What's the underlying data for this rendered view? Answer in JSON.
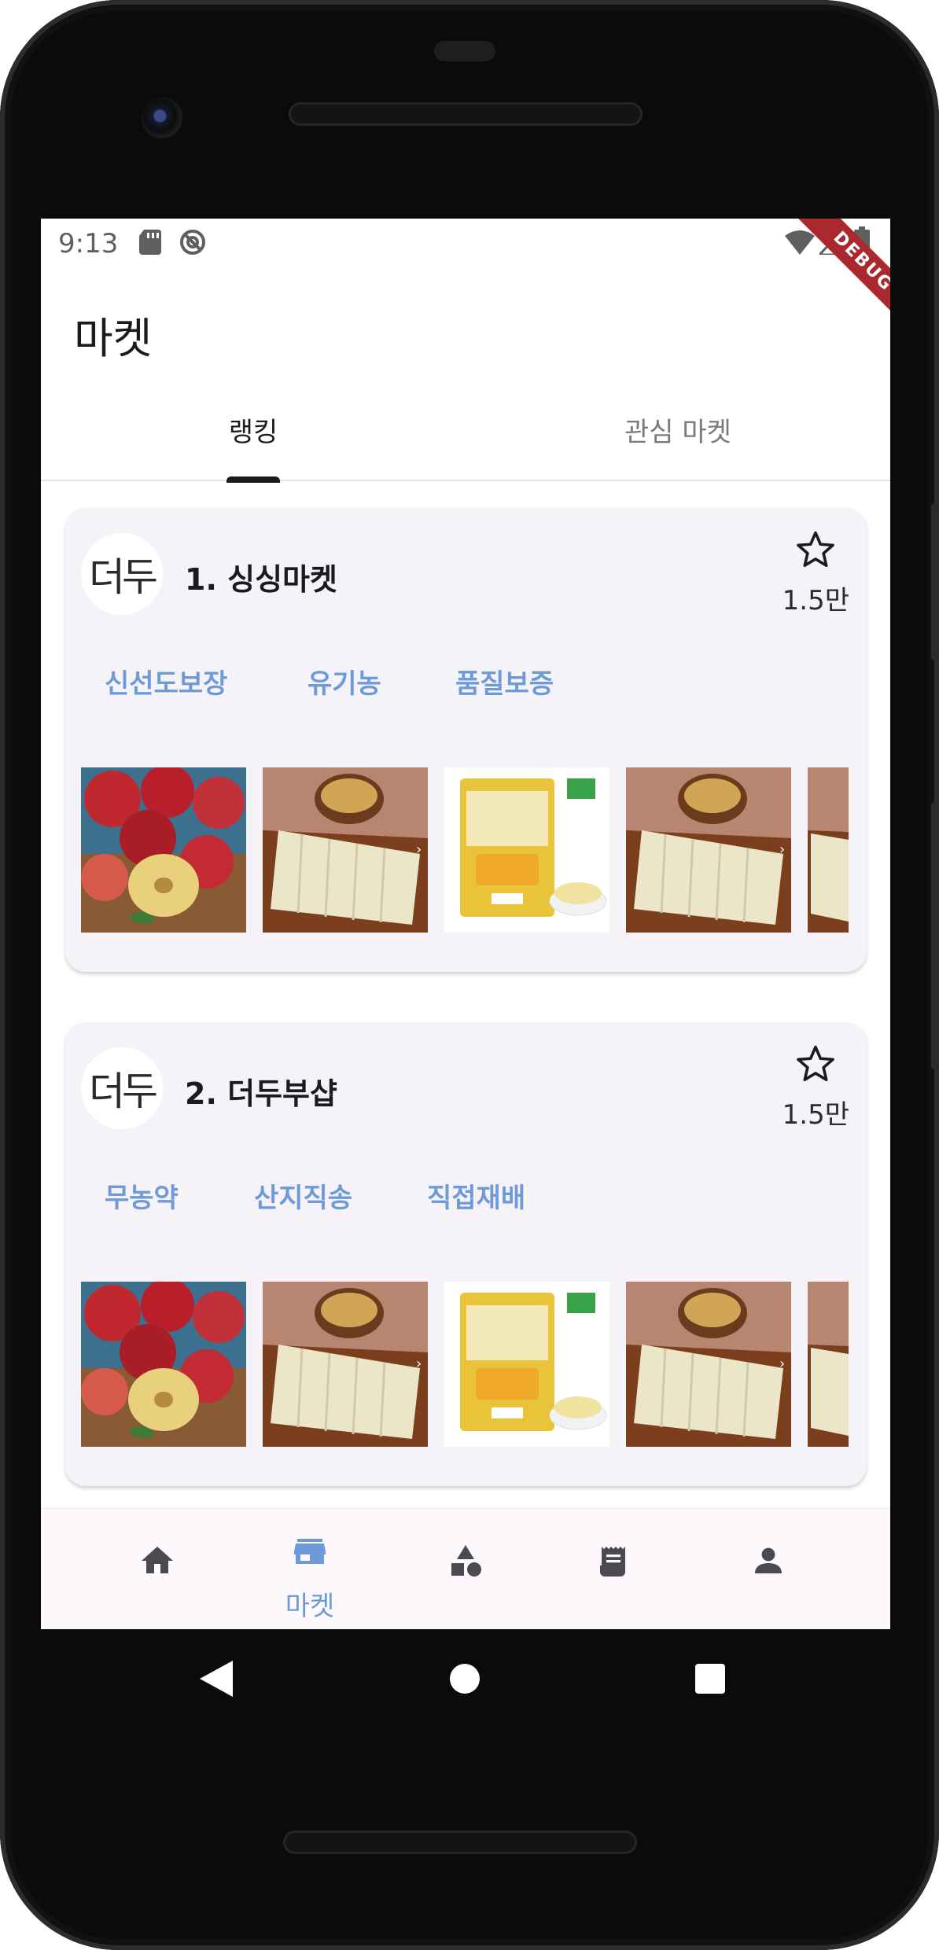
{
  "status_bar": {
    "time": "9:13",
    "debug_label": "DEBUG"
  },
  "app_bar": {
    "title": "마켓"
  },
  "tabs": [
    {
      "label": "랭킹",
      "selected": true
    },
    {
      "label": "관심 마켓",
      "selected": false
    }
  ],
  "markets": [
    {
      "logo_text": "더두",
      "name": "1. 싱싱마켓",
      "likes": "1.5만",
      "tags": [
        "신선도보장",
        "유기농",
        "품질보증"
      ],
      "products": [
        "apple-image",
        "tofu-image",
        "bean-sprouts-image",
        "tofu-image",
        "tofu-image"
      ]
    },
    {
      "logo_text": "더두",
      "name": "2. 더두부샵",
      "likes": "1.5만",
      "tags": [
        "무농약",
        "산지직송",
        "직접재배"
      ],
      "products": [
        "apple-image",
        "tofu-image",
        "bean-sprouts-image",
        "tofu-image",
        "tofu-image"
      ]
    }
  ],
  "bottom_nav": {
    "items": [
      {
        "icon": "home-icon",
        "label": ""
      },
      {
        "icon": "store-icon",
        "label": "마켓",
        "selected": true
      },
      {
        "icon": "category-icon",
        "label": ""
      },
      {
        "icon": "receipt-icon",
        "label": ""
      },
      {
        "icon": "person-icon",
        "label": ""
      }
    ]
  },
  "colors": {
    "accent": "#6e9bd8",
    "card_background": "#f5f3f8",
    "debug_ribbon": "#a9292e"
  }
}
